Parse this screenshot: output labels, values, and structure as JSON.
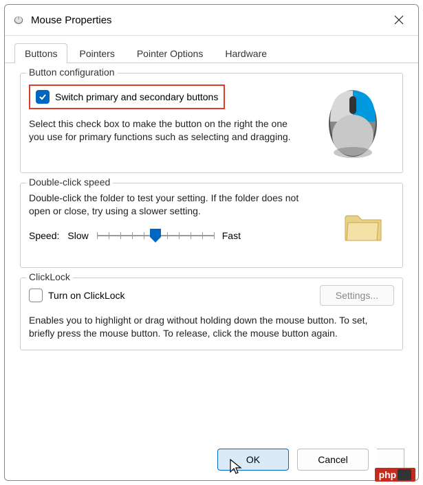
{
  "title": "Mouse Properties",
  "tabs": [
    "Buttons",
    "Pointers",
    "Pointer Options",
    "Hardware"
  ],
  "activeTab": 0,
  "buttonConfig": {
    "groupLabel": "Button configuration",
    "checkboxChecked": true,
    "checkboxLabel": "Switch primary and secondary buttons",
    "description": "Select this check box to make the button on the right the one you use for primary functions such as selecting and dragging."
  },
  "doubleClick": {
    "groupLabel": "Double-click speed",
    "description": "Double-click the folder to test your setting. If the folder does not open or close, try using a slower setting.",
    "speedLabel": "Speed:",
    "slowLabel": "Slow",
    "fastLabel": "Fast"
  },
  "clickLock": {
    "groupLabel": "ClickLock",
    "checkboxChecked": false,
    "checkboxLabel": "Turn on ClickLock",
    "settingsLabel": "Settings...",
    "description": "Enables you to highlight or drag without holding down the mouse button. To set, briefly press the mouse button. To release, click the mouse button again."
  },
  "footer": {
    "ok": "OK",
    "cancel": "Cancel"
  },
  "badge": "php"
}
